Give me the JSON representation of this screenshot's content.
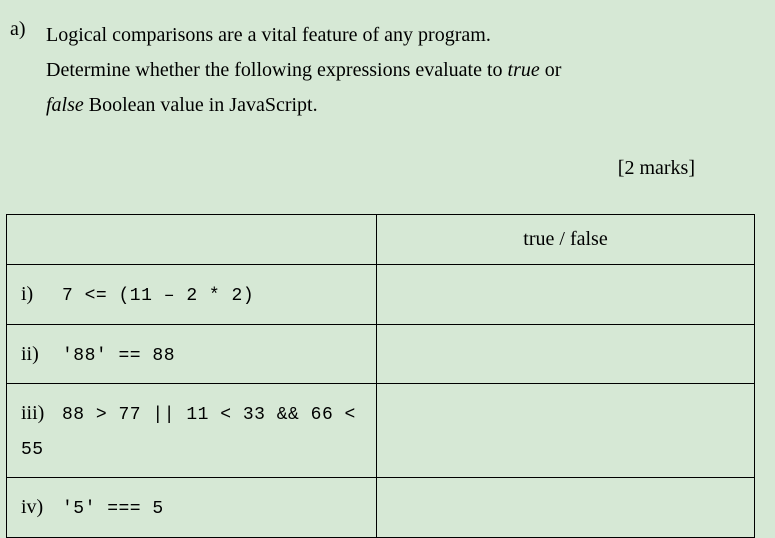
{
  "question": {
    "letter": "a)",
    "text_line1": "Logical comparisons are a vital feature of any program.",
    "text_line2_pre": "Determine whether the following expressions evaluate to ",
    "text_true": "true",
    "text_line2_mid": " or",
    "text_false": "false",
    "text_line3_post": " Boolean value in JavaScript.",
    "marks": "[2 marks]"
  },
  "table": {
    "header_answer": "true / false",
    "rows": [
      {
        "label": "i)",
        "expr": "7 <= (11 – 2 * 2)",
        "answer": ""
      },
      {
        "label": "ii)",
        "expr": "'88' == 88",
        "answer": ""
      },
      {
        "label": "iii)",
        "expr": "88 > 77 || 11 < 33 && 66 < 55",
        "answer": ""
      },
      {
        "label": "iv)",
        "expr": "'5' === 5",
        "answer": ""
      }
    ]
  }
}
